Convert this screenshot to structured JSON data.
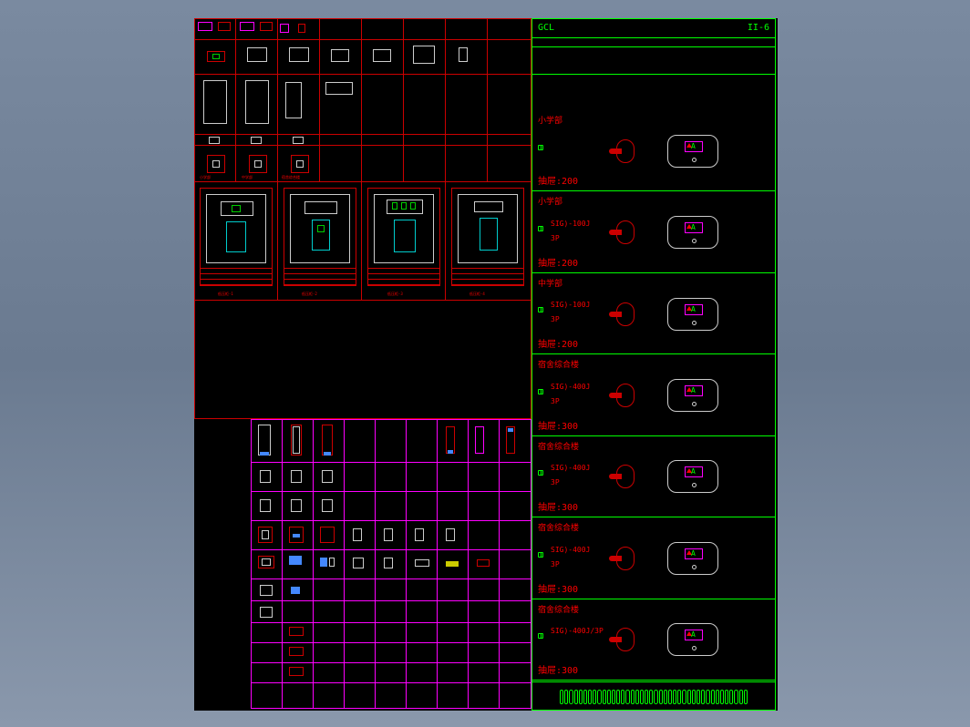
{
  "header": {
    "left": "GCL",
    "right": "II-6"
  },
  "rows": [
    {
      "title": "小学部",
      "breaker": "",
      "poles": "",
      "drawer": "抽屉:200"
    },
    {
      "title": "小学部",
      "breaker": "SIG)-100J",
      "poles": "3P",
      "drawer": "抽屉:200"
    },
    {
      "title": "中学部",
      "breaker": "SIG)-100J",
      "poles": "3P",
      "drawer": "抽屉:200"
    },
    {
      "title": "宿舍综合楼",
      "breaker": "SIG)-400J",
      "poles": "3P",
      "drawer": "抽屉:300"
    },
    {
      "title": "宿舍综合楼",
      "breaker": "SIG)-400J",
      "poles": "3P",
      "drawer": "抽屉:300"
    },
    {
      "title": "宿舍综合楼",
      "breaker": "SIG)-400J",
      "poles": "3P",
      "drawer": "抽屉:300"
    },
    {
      "title": "宿舍综合楼",
      "breaker": "SIG)-400J/3P",
      "poles": "",
      "drawer": "抽屉:300"
    }
  ],
  "topgrid_labels": [
    "小学部",
    "中学部",
    "宿舍综合楼"
  ],
  "drawing_captions": [
    "低压柜-1",
    "低压柜-2",
    "低压柜-3",
    "低压柜-4"
  ]
}
